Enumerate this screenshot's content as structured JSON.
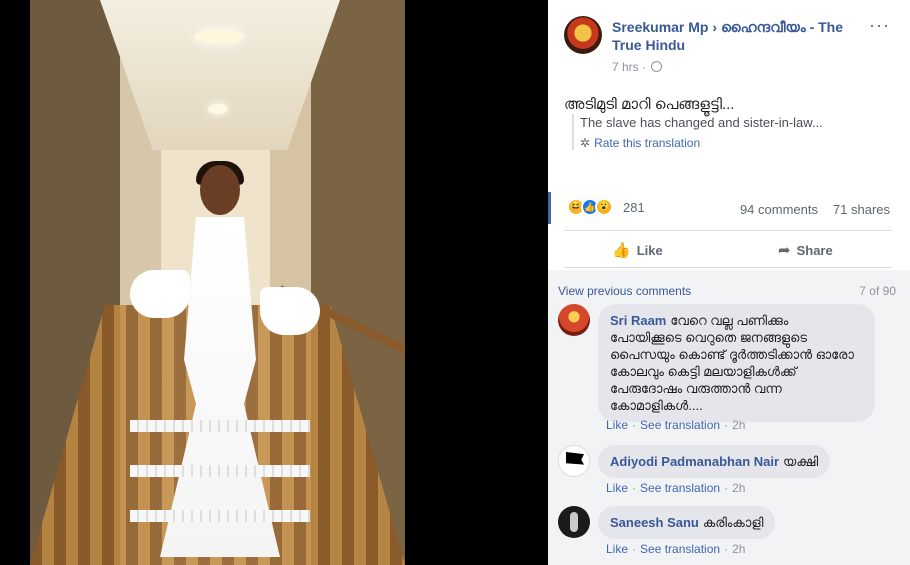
{
  "post": {
    "author": "Sreekumar Mp",
    "separator": "›",
    "group": "ഹൈന്ദവീയം - The True Hindu",
    "time": "7 hrs",
    "privacy_icon": "globe-icon",
    "text": "അടിമുടി മാറി പെങ്ങളൂട്ടി...",
    "translation": "The slave has changed and sister-in-law...",
    "rate_translation": "Rate this translation",
    "more_label": "···"
  },
  "stats": {
    "reactions": [
      "haha",
      "like",
      "wow"
    ],
    "reaction_count": "281",
    "comments": "94 comments",
    "shares": "71 shares"
  },
  "actions": {
    "like": "Like",
    "share": "Share"
  },
  "comments": {
    "view_previous": "View previous comments",
    "count": "7 of 90",
    "items": [
      {
        "name": "Sri Raam",
        "text": "വേറെ വല്ല പണിക്കും പോയിക്കൂടെ വെറുതെ ജനങ്ങളുടെ പൈസയും കൊണ്ട് ദൂർത്തടിക്കാൻ ഓരോ കോലവും കെട്ടി മലയാളികൾക്ക് പേരുദോഷം വരുത്താൻ വന്ന കോമാളികൾ....",
        "like": "Like",
        "see_translation": "See translation",
        "time": "2h"
      },
      {
        "name": "Adiyodi Padmanabhan Nair",
        "text": "യക്ഷി",
        "like": "Like",
        "see_translation": "See translation",
        "time": "2h"
      },
      {
        "name": "Saneesh Sanu",
        "text": "കരിംകാളി",
        "like": "Like",
        "see_translation": "See translation",
        "time": "2h"
      }
    ]
  },
  "colors": {
    "link": "#385898",
    "accent": "#4267b2",
    "muted": "#90949c",
    "comment_bg": "#e4e6eb"
  }
}
